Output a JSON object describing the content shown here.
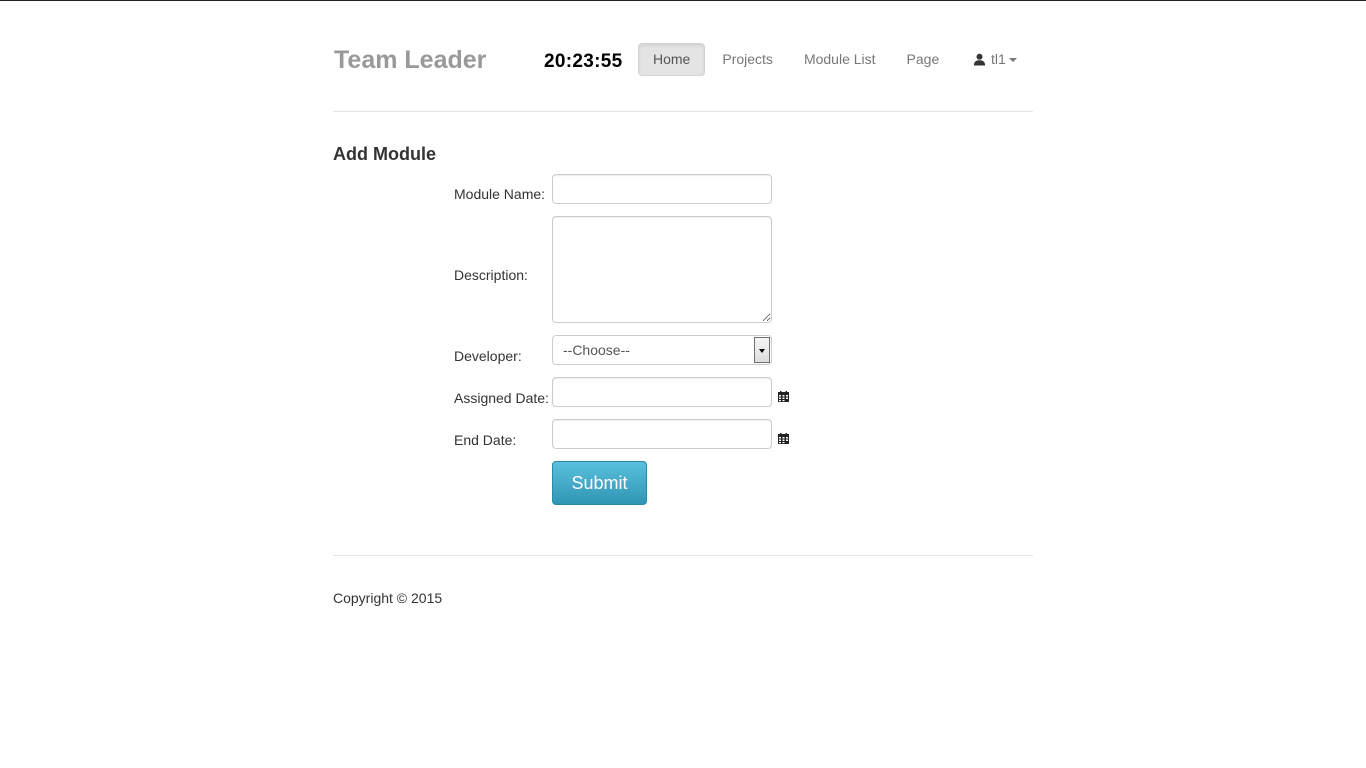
{
  "header": {
    "brand": "Team Leader",
    "clock": "20:23:55",
    "nav": [
      {
        "label": "Home",
        "active": true
      },
      {
        "label": "Projects",
        "active": false
      },
      {
        "label": "Module List",
        "active": false
      },
      {
        "label": "Page",
        "active": false
      }
    ],
    "user": {
      "name": "tl1",
      "icon": "user-icon"
    }
  },
  "page_title": "Add Module",
  "form": {
    "module_name": {
      "label": "Module Name:",
      "value": ""
    },
    "description": {
      "label": "Description:",
      "value": ""
    },
    "developer": {
      "label": "Developer:",
      "selected": "--Choose--"
    },
    "assigned_date": {
      "label": "Assigned Date:",
      "value": "",
      "icon": "calendar-icon"
    },
    "end_date": {
      "label": "End Date:",
      "value": "",
      "icon": "calendar-icon"
    },
    "submit_label": "Submit"
  },
  "footer": {
    "copyright": "Copyright © 2015"
  },
  "colors": {
    "brand": "#999999",
    "nav_active_bg": "#e4e4e4",
    "submit_bg": "#3aa8c9",
    "rule": "#e5e5e5"
  }
}
